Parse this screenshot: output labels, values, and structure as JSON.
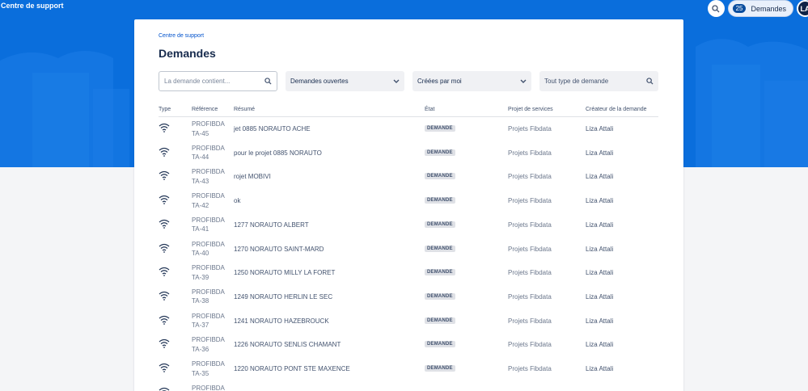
{
  "header": {
    "brand": "Centre de support",
    "requests_count": "25",
    "requests_label": "Demandes",
    "avatar_initials": "LA",
    "accent_color": "#0a6edc"
  },
  "breadcrumb": "Centre de support",
  "page_title": "Demandes",
  "filters": {
    "search_placeholder": "La demande contient...",
    "status_value": "Demandes ouvertes",
    "creator_value": "Créées par moi",
    "type_placeholder": "Tout type de demande"
  },
  "table": {
    "columns": [
      "Type",
      "Référence",
      "Résumé",
      "État",
      "Projet de services",
      "Créateur de la demande"
    ],
    "rows": [
      {
        "ref": "PROFIBDA TA-45",
        "summary": "jet 0885 NORAUTO ACHE",
        "status": "DEMANDE",
        "project": "Projets Fibdata",
        "creator": "Liza Attali"
      },
      {
        "ref": "PROFIBDA TA-44",
        "summary": "pour le projet 0885 NORAUTO",
        "status": "DEMANDE",
        "project": "Projets Fibdata",
        "creator": "Liza Attali"
      },
      {
        "ref": "PROFIBDA TA-43",
        "summary": "rojet MOBIVI",
        "status": "DEMANDE",
        "project": "Projets Fibdata",
        "creator": "Liza Attali"
      },
      {
        "ref": "PROFIBDA TA-42",
        "summary": "ok",
        "status": "DEMANDE",
        "project": "Projets Fibdata",
        "creator": "Liza Attali"
      },
      {
        "ref": "PROFIBDA TA-41",
        "summary": "1277 NORAUTO ALBERT",
        "status": "DEMANDE",
        "project": "Projets Fibdata",
        "creator": "Liza Attali"
      },
      {
        "ref": "PROFIBDA TA-40",
        "summary": "1270 NORAUTO SAINT-MARD",
        "status": "DEMANDE",
        "project": "Projets Fibdata",
        "creator": "Liza Attali"
      },
      {
        "ref": "PROFIBDA TA-39",
        "summary": "1250 NORAUTO MILLY LA FORET",
        "status": "DEMANDE",
        "project": "Projets Fibdata",
        "creator": "Liza Attali"
      },
      {
        "ref": "PROFIBDA TA-38",
        "summary": "1249 NORAUTO HERLIN LE SEC",
        "status": "DEMANDE",
        "project": "Projets Fibdata",
        "creator": "Liza Attali"
      },
      {
        "ref": "PROFIBDA TA-37",
        "summary": "1241 NORAUTO HAZEBROUCK",
        "status": "DEMANDE",
        "project": "Projets Fibdata",
        "creator": "Liza Attali"
      },
      {
        "ref": "PROFIBDA TA-36",
        "summary": "1226 NORAUTO SENLIS CHAMANT",
        "status": "DEMANDE",
        "project": "Projets Fibdata",
        "creator": "Liza Attali"
      },
      {
        "ref": "PROFIBDA TA-35",
        "summary": "1220 NORAUTO PONT STE MAXENCE",
        "status": "DEMANDE",
        "project": "Projets Fibdata",
        "creator": "Liza Attali"
      },
      {
        "ref": "PROFIBDA",
        "summary": "",
        "status": "",
        "project": "",
        "creator": ""
      }
    ]
  }
}
